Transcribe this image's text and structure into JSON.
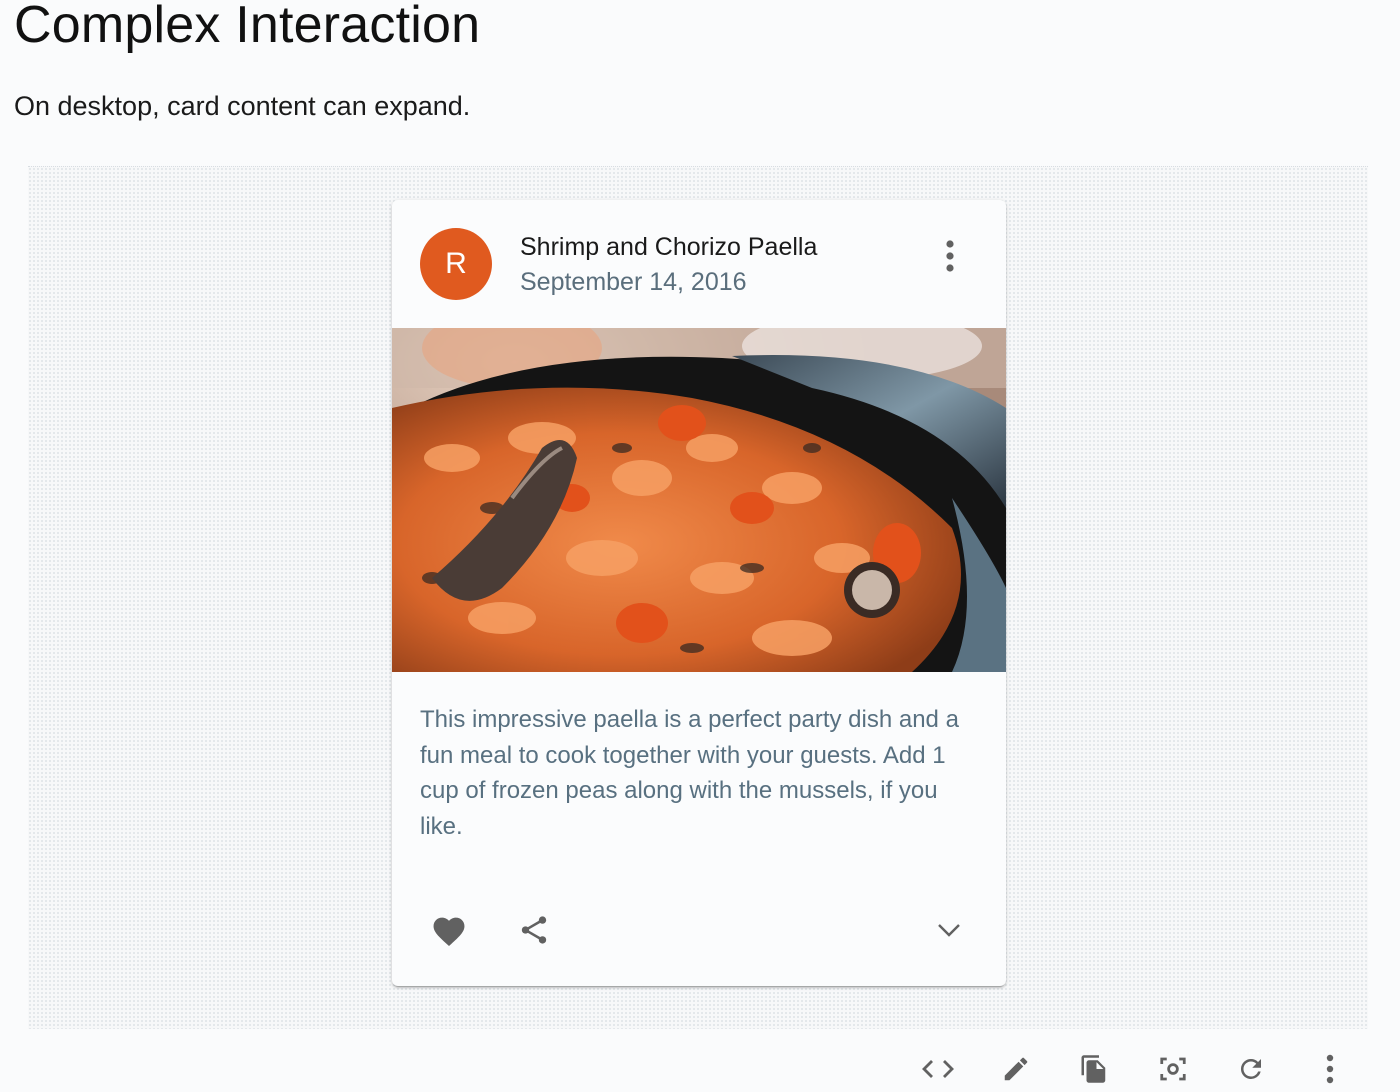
{
  "page": {
    "title": "Complex Interaction",
    "description": "On desktop, card content can expand."
  },
  "card": {
    "avatar_letter": "R",
    "title": "Shrimp and Chorizo Paella",
    "subheader": "September 14, 2016",
    "body": "This impressive paella is a perfect party dish and a fun meal to cook together with your guests. Add 1 cup of frozen peas along with the mussels, if you like.",
    "media_alt": "paella-photo",
    "actions": {
      "favorite": "heart-icon",
      "share": "share-icon",
      "expand": "chevron-down-icon"
    }
  },
  "toolbar": {
    "items": [
      "code-icon",
      "edit-icon",
      "copy-icon",
      "screenshot-icon",
      "refresh-icon",
      "more-vert-icon"
    ]
  },
  "colors": {
    "avatar": "#e05a1f",
    "subheader": "#5a6e7c",
    "body_text": "#587080",
    "icon": "#616161",
    "background": "#fafbfc"
  }
}
